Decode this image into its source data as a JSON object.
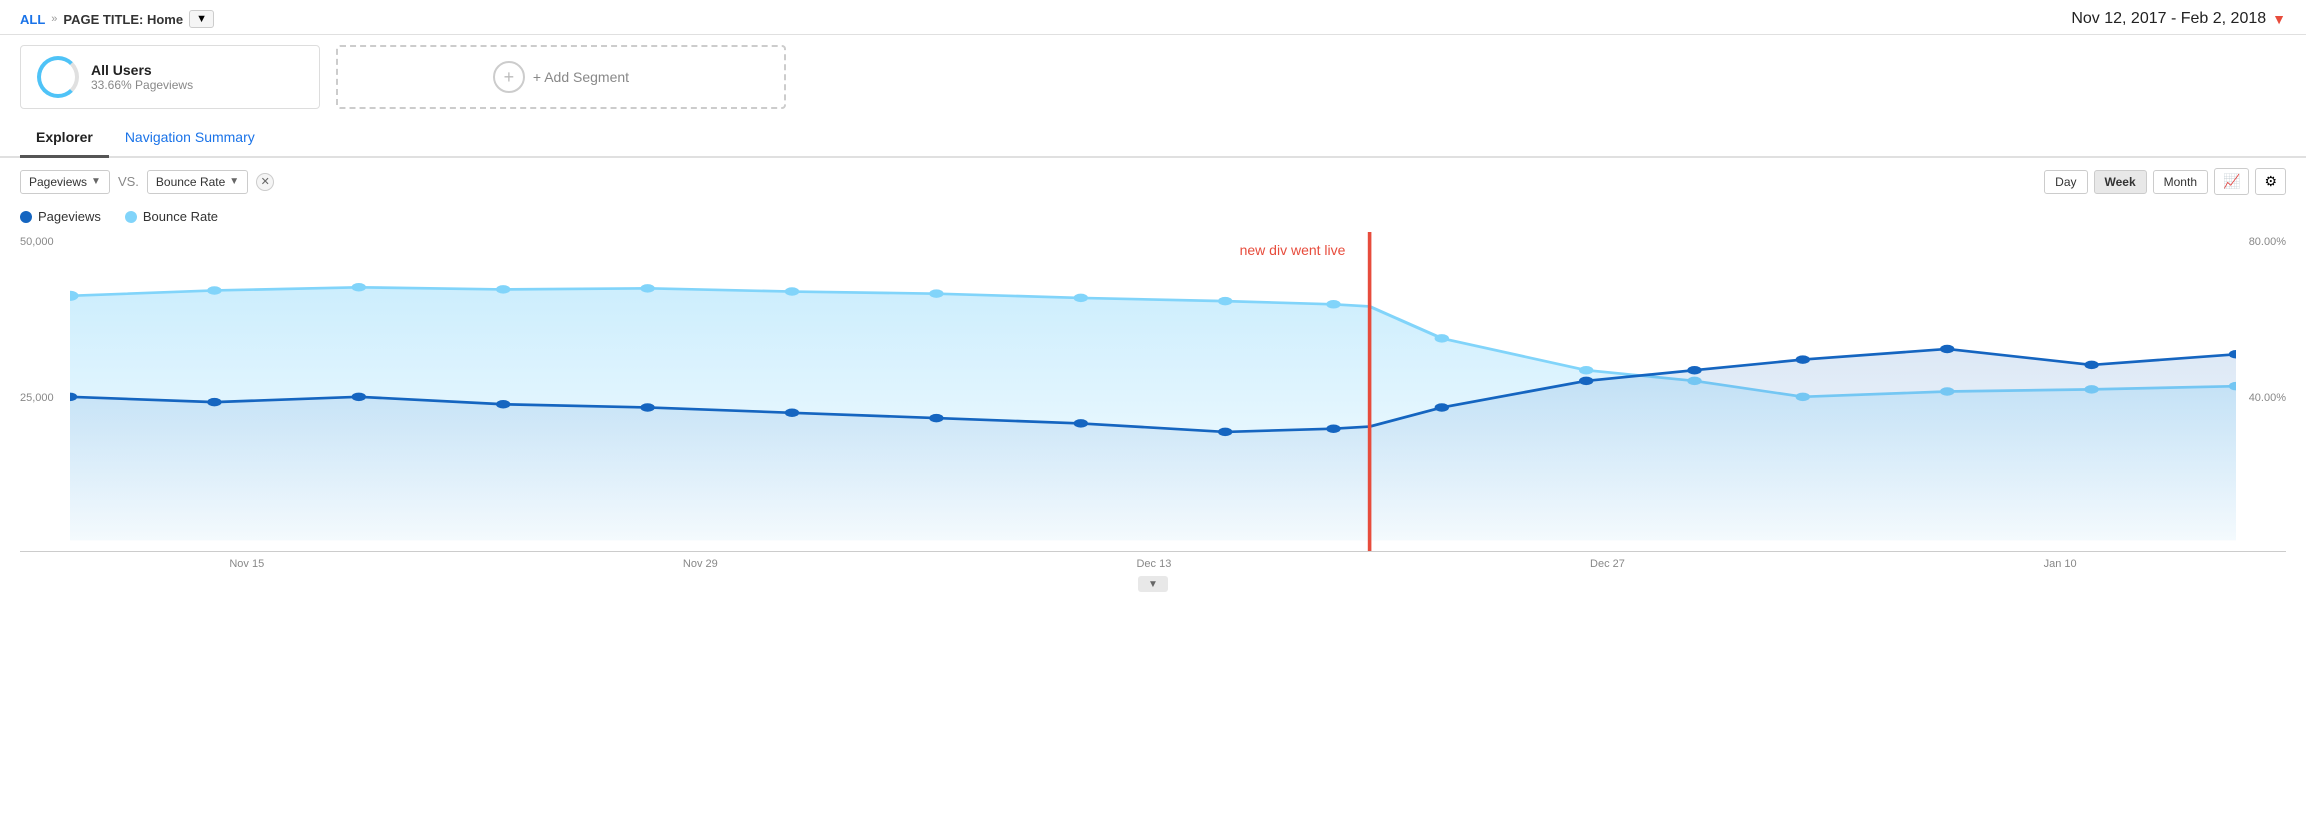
{
  "header": {
    "all_label": "ALL",
    "separator": "»",
    "page_title_label": "PAGE TITLE: Home",
    "dropdown_arrow": "▼",
    "date_range": "Nov 12, 2017 - Feb 2, 2018",
    "date_dropdown": "▼"
  },
  "segments": {
    "segment1": {
      "title": "All Users",
      "subtitle": "33.66% Pageviews"
    },
    "add_segment": {
      "label": "+ Add Segment"
    }
  },
  "tabs": [
    {
      "label": "Explorer",
      "active": true
    },
    {
      "label": "Navigation Summary",
      "active": false
    }
  ],
  "controls": {
    "metric1": "Pageviews",
    "vs_label": "VS.",
    "metric2": "Bounce Rate",
    "periods": [
      "Day",
      "Week",
      "Month"
    ],
    "active_period": "Week"
  },
  "legend": [
    {
      "label": "Pageviews",
      "color": "#1565c0"
    },
    {
      "label": "Bounce Rate",
      "color": "#81d4fa"
    }
  ],
  "chart": {
    "annotation_label": "new div went live",
    "y_left": [
      "50,000",
      "25,000"
    ],
    "y_right": [
      "80.00%",
      "40.00%"
    ],
    "x_labels": [
      "Nov 15",
      "Nov 29",
      "Dec 13",
      "Dec 27",
      "Jan 10"
    ]
  }
}
